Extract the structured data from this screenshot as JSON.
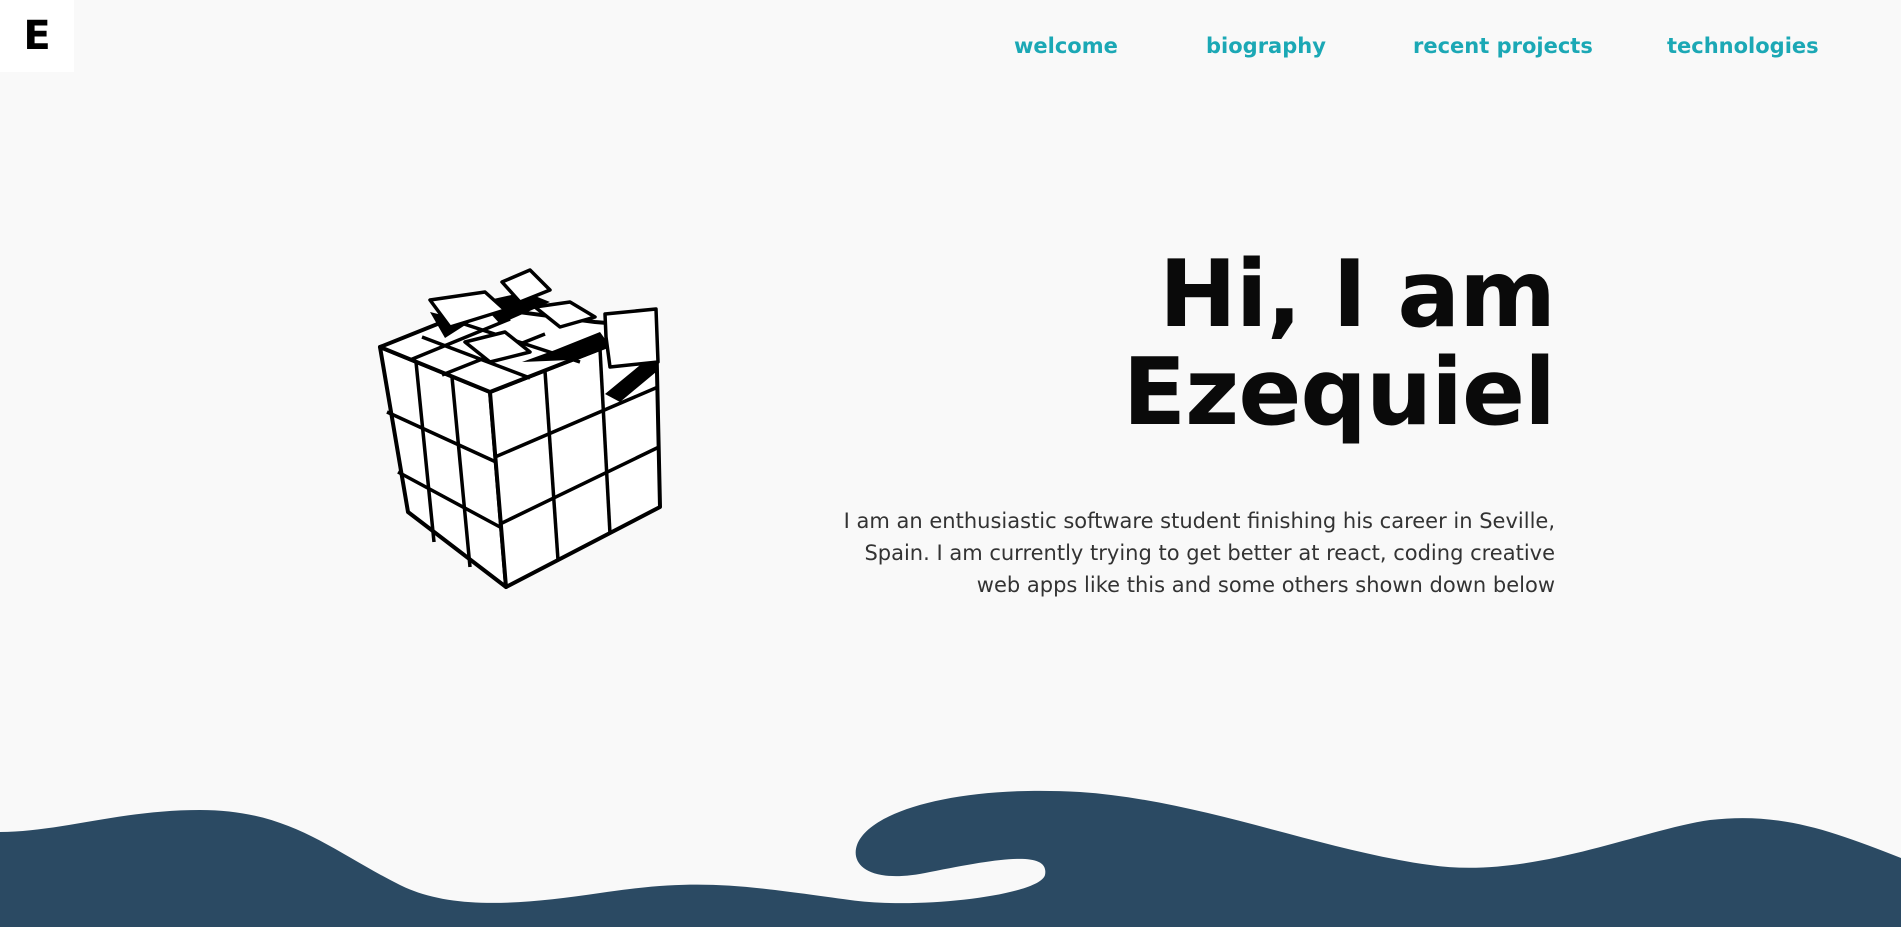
{
  "logo": {
    "letter": "E"
  },
  "nav": {
    "welcome": "welcome",
    "biography": "biography",
    "recent_projects": "recent projects",
    "technologies": "technologies"
  },
  "hero": {
    "title_line1": "Hi, I am",
    "title_line2": "Ezequiel",
    "description": "I am an enthusiastic software student finishing his career in Seville, Spain. I am currently trying to get better at react, coding creative web apps like this and some others shown down below"
  },
  "illustration": {
    "icon": "rubiks-cube-icon"
  },
  "colors": {
    "background": "#f9f9f9",
    "nav_accent": "#1ba8b5",
    "wave": "#2b4a63",
    "title": "#0a0a0a"
  }
}
